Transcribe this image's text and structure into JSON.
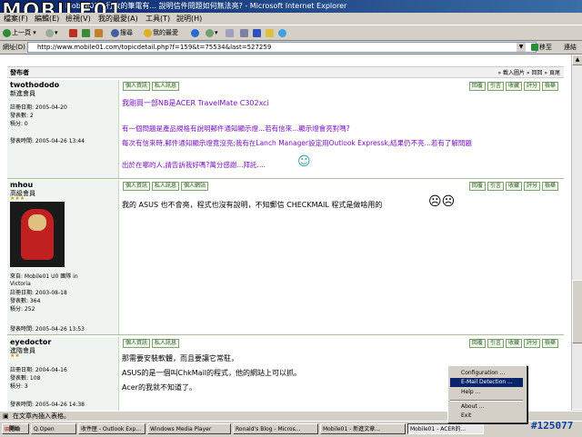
{
  "window": {
    "title": "Mobile01 - 行政的筆電有... 說明信件問題如何無法亮? - Microsoft Internet Explorer",
    "logo_text": "MOBILE01"
  },
  "menu": [
    "檔案(F)",
    "編輯(E)",
    "檢視(V)",
    "我的最愛(A)",
    "工具(T)",
    "說明(H)"
  ],
  "toolbar": {
    "back": "上一頁",
    "search": "搜尋",
    "favorites": "我的最愛"
  },
  "address": {
    "label": "網址(D)",
    "url": "http://www.mobile01.com/topicdetail.php?f=159&t=75534&last=527259",
    "go": "移至",
    "links": "連結"
  },
  "topbar": {
    "left": "發布者",
    "right": "» 載入圖片 » 回回 » 頁尾"
  },
  "tags": {
    "personal": "個人資訊",
    "pm": "私人訊息",
    "website": "個人網站",
    "reply": "回覆",
    "quote": "引言",
    "collect": "收藏",
    "rate": "評分",
    "edit": "檢舉"
  },
  "posts": [
    {
      "user": "twothododo",
      "rank": "新進會員",
      "meta": [
        "註冊日期: 2005-04-20",
        "發表數: 2",
        "積分: 0"
      ],
      "time": "發表時間: 2005-04-26 13:44",
      "lines": [
        "我剛買一部NB是ACER TravelMate C302xci",
        "有一個問題是產品規格有說明郵件通知顯示燈...若有信來...顯示燈會亮對嗎?",
        "每次有信來時,郵件通知顯示燈竟沒亮;我有在Lanch Manager設定用Outlook Expressk,結果仍不亮...若有了解問題",
        "出於在哪的人,請告訴我好嗎?萬分感謝...拜託...."
      ]
    },
    {
      "user": "mhou",
      "rank": "高級會員",
      "meta": [
        "來自: Mobile01 U0 團隊 in",
        "Victoria",
        "註冊日期: 2003-08-18",
        "發表數: 364",
        "積分: 252"
      ],
      "time": "發表時間: 2005-04-26 13:53",
      "lines": [
        "我的 ASUS 也不會亮，程式也沒有說明，不知郵信 CHECKMAIL 程式是做啥用的"
      ]
    },
    {
      "user": "eyedoctor",
      "rank": "進階會員",
      "meta": [
        "註冊日期: 2004-04-16",
        "發表數: 108",
        "積分: 3"
      ],
      "time": "發表時間: 2005-04-26 14:38",
      "lines": [
        "那需要安裝軟體，而且要讓它常駐，",
        "ASUS的是一個叫ChkMail的程式，他的網站上可以抓。",
        "Acer的我就不知道了。"
      ]
    }
  ],
  "status": {
    "text": "在文章內插入表格。"
  },
  "taskbar": {
    "start": "開始",
    "tasks": [
      "Q.Open",
      "收件匣 - Outlook Exp...",
      "Windows Media Player",
      "Ronald's Blog - Micros...",
      "Mobile01 - 新進文章...",
      "Mobile01 - ACER的..."
    ]
  },
  "context_menu": {
    "items": [
      "Configuration ...",
      "E-Mail Detection ...",
      "Help ...",
      "About ...",
      "Exit"
    ],
    "selected": "E-Mail Detection ..."
  },
  "watermark": "#125077"
}
